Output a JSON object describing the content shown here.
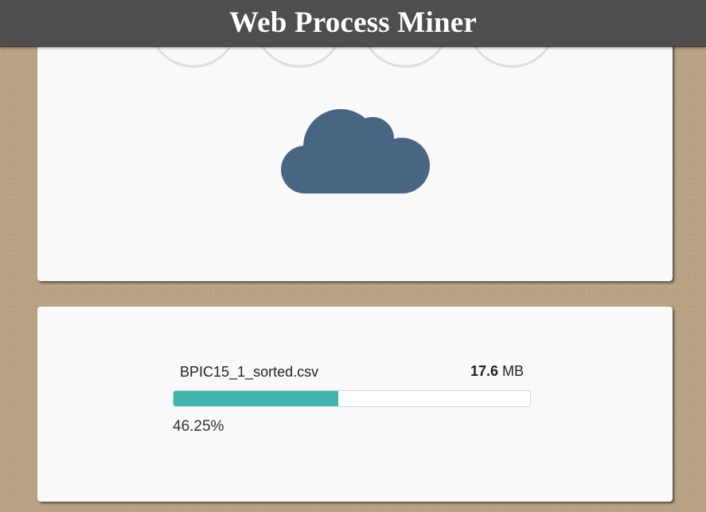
{
  "app": {
    "title": "Web Process Miner"
  },
  "steps": {
    "icons": [
      "file-step-icon",
      "send-step-icon",
      "process-step-icon",
      "result-step-icon"
    ]
  },
  "dropzone": {
    "icon": "cloud-icon",
    "color": "#4a6584"
  },
  "upload": {
    "file_name": "BPIC15_1_sorted.csv",
    "size_value": "17.6",
    "size_unit": "MB",
    "progress_fraction": 0.4625,
    "progress_text": "46.25%",
    "progress_color": "#41b4a9"
  }
}
